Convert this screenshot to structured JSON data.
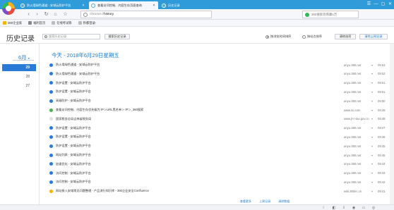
{
  "colors": {
    "tabstrip": "#2f9bd8",
    "accent": "#1a7ad0",
    "active_day": "#2a7bd6"
  },
  "tabs": [
    {
      "label": "防火墙绿色通道 - 安域云防护平台",
      "active": false
    },
    {
      "label": "查看访问控制、内容生存页面查询",
      "active": true
    },
    {
      "label": "历史记录",
      "active": false
    }
  ],
  "window_controls": [
    "☰",
    "—",
    "▢",
    "✕"
  ],
  "nav": {
    "back": "‹",
    "forward": "›",
    "refresh": "↻",
    "home": "⌂",
    "star": "☆",
    "address_scheme": "chrome://",
    "address_path": "history",
    "search_placeholder": "360搜索亮燕康4万"
  },
  "bookmarks": [
    {
      "label": "360企业家",
      "icon": "folder-icon"
    },
    {
      "label": "福利首页",
      "icon": "gift-icon"
    },
    {
      "label": "在线考试系",
      "icon": "exam-icon"
    },
    {
      "label": "秒都登录-",
      "icon": "login-icon"
    }
  ],
  "page": {
    "title": "历史记录",
    "search_placeholder": "搜索历史记录",
    "search_button": "搜索历史记录",
    "sort_by_time": "按浏览时间排序",
    "sort_by_site": "按站点排序",
    "clear_checked": "清除选项",
    "clear_all": "清除上网记录"
  },
  "sidebar": {
    "month": "6月",
    "days": [
      "29",
      "28",
      "27"
    ]
  },
  "date_heading": "今天 - 2018年6月29日星期五",
  "history": [
    {
      "title": "防火墙绿色通道 - 安域云防护平台",
      "domain": "anyu.360.net",
      "time": "09:53",
      "icon_color": "#2a7bd6"
    },
    {
      "title": "防火墙绿色通道 - 安域云防护平台",
      "domain": "anyu.360.net",
      "time": "09:52",
      "icon_color": "#2a7bd6"
    },
    {
      "title": "防护设置 - 安域云防护平台",
      "domain": "anyu.360.net",
      "time": "09:51",
      "icon_color": "#2a7bd6"
    },
    {
      "title": "防护设置 - 安域云防护平台",
      "domain": "anyu.360.net",
      "time": "09:51",
      "icon_color": "#2a7bd6"
    },
    {
      "title": "高级防护 - 安域云防护平台",
      "domain": "anyu.360.net",
      "time": "09:50",
      "icon_color": "#2a7bd6"
    },
    {
      "title": "查看访问控制、内容生存优先级为 IP＞URL黑名单＞ IP＞_360搜索",
      "domain": "www.so.com",
      "time": "09:49",
      "icon_color": "#4caf50"
    },
    {
      "title": "国家税务总局吉林省税务局",
      "domain": "www.jl-n-tax.gov.cn",
      "time": "09:48",
      "icon_color": "#e0e0e0"
    },
    {
      "title": "防护设置 - 安域云防护平台",
      "domain": "anyu.360.net",
      "time": "09:47",
      "icon_color": "#2a7bd6"
    },
    {
      "title": "防护设置 - 安域云防护平台",
      "domain": "anyu.360.net",
      "time": "09:46",
      "icon_color": "#2a7bd6"
    },
    {
      "title": "防护设置 - 安域云防护平台",
      "domain": "anyu.360.net",
      "time": "09:45",
      "icon_color": "#2a7bd6"
    },
    {
      "title": "网站列表 - 安域云防护平台",
      "domain": "anyu.360.net",
      "time": "09:45",
      "icon_color": "#2a7bd6"
    },
    {
      "title": "加速优化 - 安域云防护平台",
      "domain": "anyu.360.net",
      "time": "09:44",
      "icon_color": "#2a7bd6"
    },
    {
      "title": "访问控制 - 安域云防护平台",
      "domain": "anyu.360.net",
      "time": "09:43",
      "icon_color": "#2a7bd6"
    },
    {
      "title": "访问控制 - 安域云防护平台",
      "domain": "anyu.360.net",
      "time": "09:42",
      "icon_color": "#2a7bd6"
    },
    {
      "title": "网站接入安域常见问题整理 - 产品流行知识库 - 360企业安全Confluence",
      "domain": "wiki.360ec.cn",
      "time": "09:41",
      "icon_color": "#f4b400"
    }
  ],
  "bottom_links": [
    "查看更多",
    "上周记录",
    "清除数据"
  ],
  "status_icons": [
    "☾",
    "◧",
    "⇩",
    "◉",
    "▭",
    "◎"
  ]
}
